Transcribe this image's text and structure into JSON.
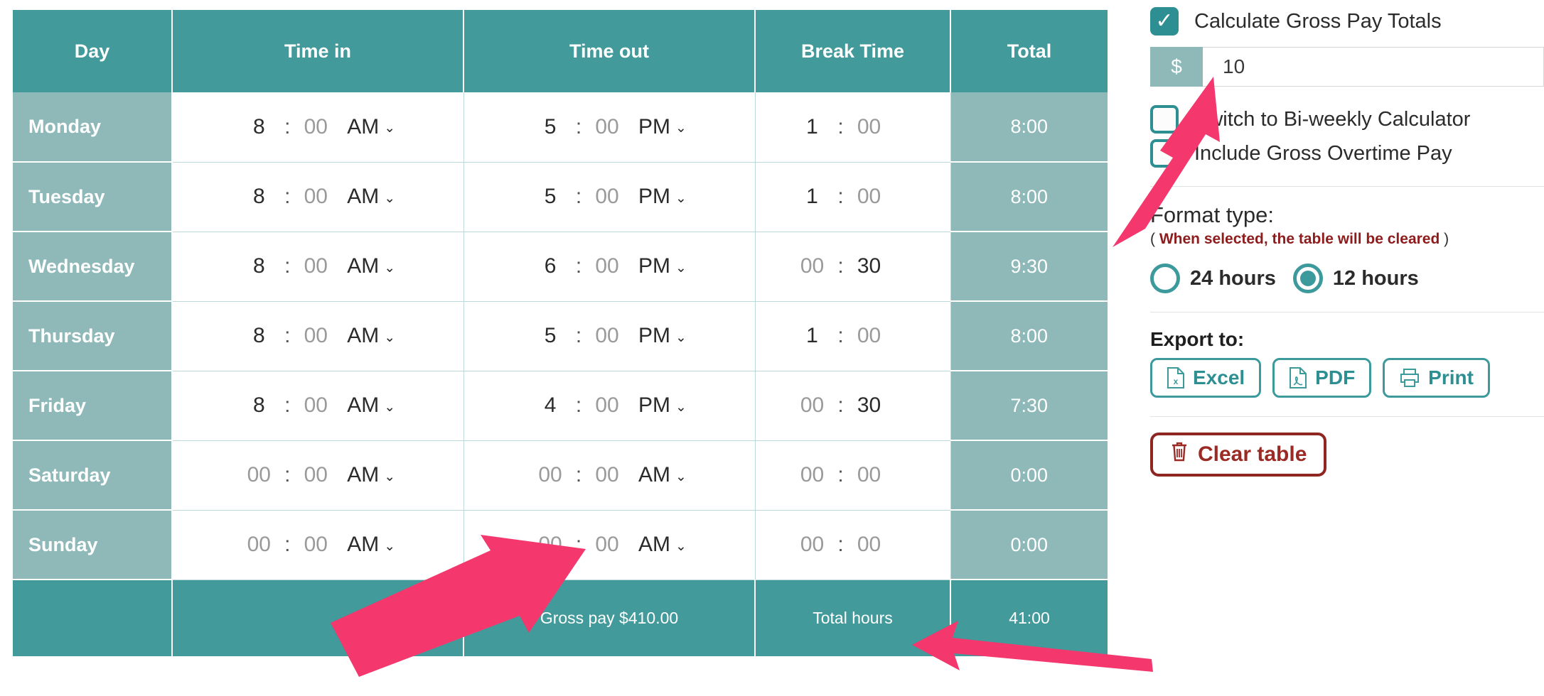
{
  "table": {
    "headers": [
      "Day",
      "Time in",
      "Time out",
      "Break Time",
      "Total"
    ],
    "rows": [
      {
        "day": "Monday",
        "in_h": "8",
        "in_m": "00",
        "in_ap": "AM",
        "in_h_ph": false,
        "in_m_ph": true,
        "out_h": "5",
        "out_m": "00",
        "out_ap": "PM",
        "out_h_ph": false,
        "out_m_ph": true,
        "brk_h": "1",
        "brk_m": "00",
        "brk_h_ph": false,
        "brk_m_ph": true,
        "total": "8:00"
      },
      {
        "day": "Tuesday",
        "in_h": "8",
        "in_m": "00",
        "in_ap": "AM",
        "in_h_ph": false,
        "in_m_ph": true,
        "out_h": "5",
        "out_m": "00",
        "out_ap": "PM",
        "out_h_ph": false,
        "out_m_ph": true,
        "brk_h": "1",
        "brk_m": "00",
        "brk_h_ph": false,
        "brk_m_ph": true,
        "total": "8:00"
      },
      {
        "day": "Wednesday",
        "in_h": "8",
        "in_m": "00",
        "in_ap": "AM",
        "in_h_ph": false,
        "in_m_ph": true,
        "out_h": "6",
        "out_m": "00",
        "out_ap": "PM",
        "out_h_ph": false,
        "out_m_ph": true,
        "brk_h": "00",
        "brk_m": "30",
        "brk_h_ph": true,
        "brk_m_ph": false,
        "total": "9:30"
      },
      {
        "day": "Thursday",
        "in_h": "8",
        "in_m": "00",
        "in_ap": "AM",
        "in_h_ph": false,
        "in_m_ph": true,
        "out_h": "5",
        "out_m": "00",
        "out_ap": "PM",
        "out_h_ph": false,
        "out_m_ph": true,
        "brk_h": "1",
        "brk_m": "00",
        "brk_h_ph": false,
        "brk_m_ph": true,
        "total": "8:00"
      },
      {
        "day": "Friday",
        "in_h": "8",
        "in_m": "00",
        "in_ap": "AM",
        "in_h_ph": false,
        "in_m_ph": true,
        "out_h": "4",
        "out_m": "00",
        "out_ap": "PM",
        "out_h_ph": false,
        "out_m_ph": true,
        "brk_h": "00",
        "brk_m": "30",
        "brk_h_ph": true,
        "brk_m_ph": false,
        "total": "7:30"
      },
      {
        "day": "Saturday",
        "in_h": "00",
        "in_m": "00",
        "in_ap": "AM",
        "in_h_ph": true,
        "in_m_ph": true,
        "out_h": "00",
        "out_m": "00",
        "out_ap": "AM",
        "out_h_ph": true,
        "out_m_ph": true,
        "brk_h": "00",
        "brk_m": "00",
        "brk_h_ph": true,
        "brk_m_ph": true,
        "total": "0:00"
      },
      {
        "day": "Sunday",
        "in_h": "00",
        "in_m": "00",
        "in_ap": "AM",
        "in_h_ph": true,
        "in_m_ph": true,
        "out_h": "00",
        "out_m": "00",
        "out_ap": "AM",
        "out_h_ph": true,
        "out_m_ph": true,
        "brk_h": "00",
        "brk_m": "00",
        "brk_h_ph": true,
        "brk_m_ph": true,
        "total": "0:00"
      }
    ],
    "footer": {
      "gross_pay_label": "Gross pay $410.00",
      "total_hours_label": "Total hours",
      "total_hours_value": "41:00"
    },
    "time_separator": ":",
    "caret_glyph": "⌄"
  },
  "panel": {
    "gross_pay_checkbox": {
      "label": "Calculate Gross Pay Totals",
      "checked": true,
      "check_glyph": "✓"
    },
    "rate": {
      "prefix": "$",
      "value": "10",
      "placeholder": ""
    },
    "biweekly_checkbox": {
      "label": "Switch to Bi-weekly Calculator",
      "checked": false
    },
    "overtime_checkbox": {
      "label": "Include Gross Overtime Pay",
      "checked": false
    },
    "format": {
      "title": "Format type:",
      "note_open": "(",
      "note_warning": "When selected, the table will be cleared",
      "note_close": ")",
      "options": [
        {
          "label": "24 hours",
          "selected": false
        },
        {
          "label": "12 hours",
          "selected": true
        }
      ]
    },
    "export": {
      "title": "Export to:",
      "buttons": [
        {
          "label": "Excel",
          "icon": "excel-file-icon"
        },
        {
          "label": "PDF",
          "icon": "pdf-file-icon"
        },
        {
          "label": "Print",
          "icon": "printer-icon"
        }
      ]
    },
    "clear": {
      "label": "Clear table",
      "icon": "trash-icon"
    }
  },
  "annotations": {
    "arrow_color": "#f4376d",
    "arrows": [
      {
        "name": "arrow-to-rate-input"
      },
      {
        "name": "arrow-to-gross-pay"
      },
      {
        "name": "arrow-to-total-hours"
      }
    ]
  }
}
